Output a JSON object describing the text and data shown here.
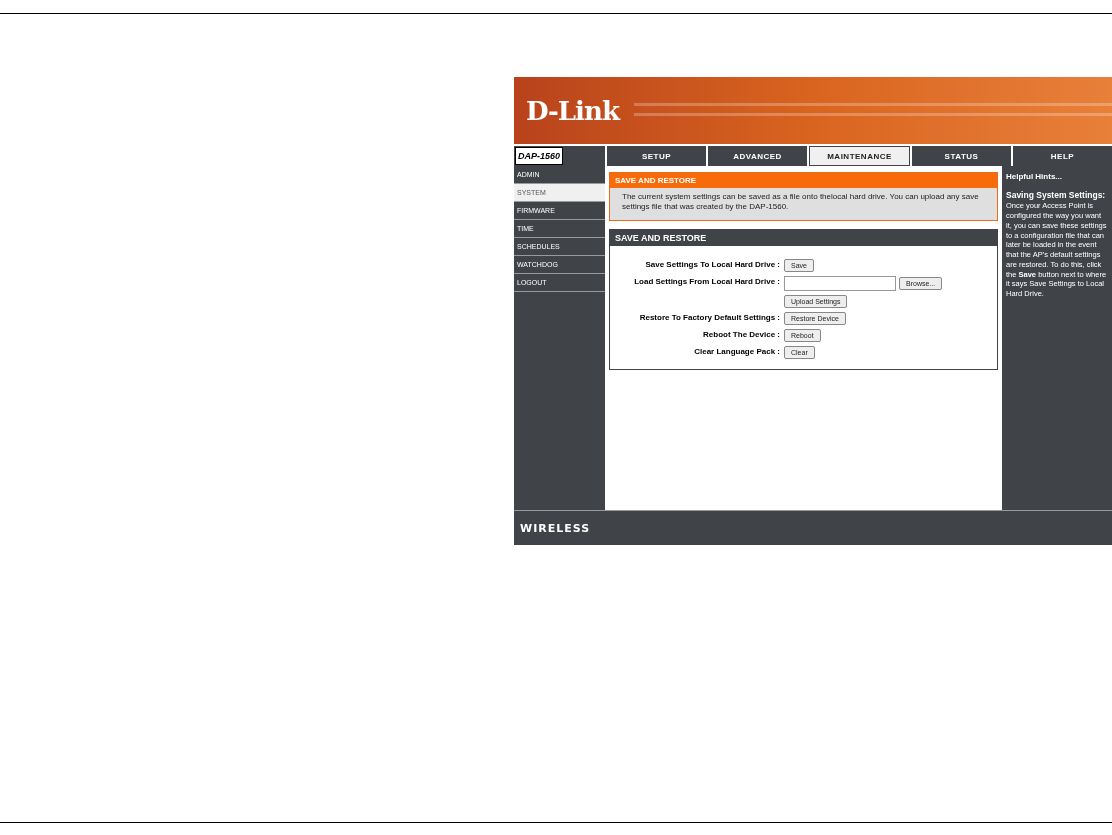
{
  "logo": "D-Link",
  "model": "DAP-1560",
  "tabs": [
    {
      "label": "SETUP",
      "selected": false
    },
    {
      "label": "ADVANCED",
      "selected": false
    },
    {
      "label": "MAINTENANCE",
      "selected": true
    },
    {
      "label": "STATUS",
      "selected": false
    },
    {
      "label": "HELP",
      "selected": false
    }
  ],
  "sidebar": {
    "items": [
      {
        "label": "ADMIN",
        "selected": false
      },
      {
        "label": "SYSTEM",
        "selected": true
      },
      {
        "label": "FIRMWARE",
        "selected": false
      },
      {
        "label": "TIME",
        "selected": false
      },
      {
        "label": "SCHEDULES",
        "selected": false
      },
      {
        "label": "WATCHDOG",
        "selected": false
      },
      {
        "label": "LOGOUT",
        "selected": false
      }
    ]
  },
  "intro": {
    "title": "SAVE AND RESTORE",
    "text": "The current system settings can be saved as a file onto thelocal hard drive. You can upload any save settings file that was created by the DAP-1560."
  },
  "form": {
    "title": "SAVE AND RESTORE",
    "rows": [
      {
        "kind": "button",
        "label": "Save Settings To Local Hard Drive :",
        "button": "Save"
      },
      {
        "kind": "file",
        "label": "Load Settings From Local Hard Drive :",
        "button": "Browse..."
      },
      {
        "kind": "button",
        "button": "Upload Settings"
      },
      {
        "kind": "button",
        "label": "Restore To Factory Default Settings :",
        "button": "Restore Device"
      },
      {
        "kind": "button",
        "label": "Reboot The Device :",
        "button": "Reboot"
      },
      {
        "kind": "button",
        "label": "Clear Language Pack :",
        "button": "Clear"
      }
    ]
  },
  "help": {
    "title": "Helpful Hints...",
    "heading": "Saving System Settings:",
    "text": "Once your Access Point is configured the way you want it, you can save these settings to a configuration file that can later be loaded in the event that the AP's default settings are restored. To do this, click the **Save** button next to where it says Save Settings to Local Hard Drive."
  },
  "footer": "WIRELESS"
}
